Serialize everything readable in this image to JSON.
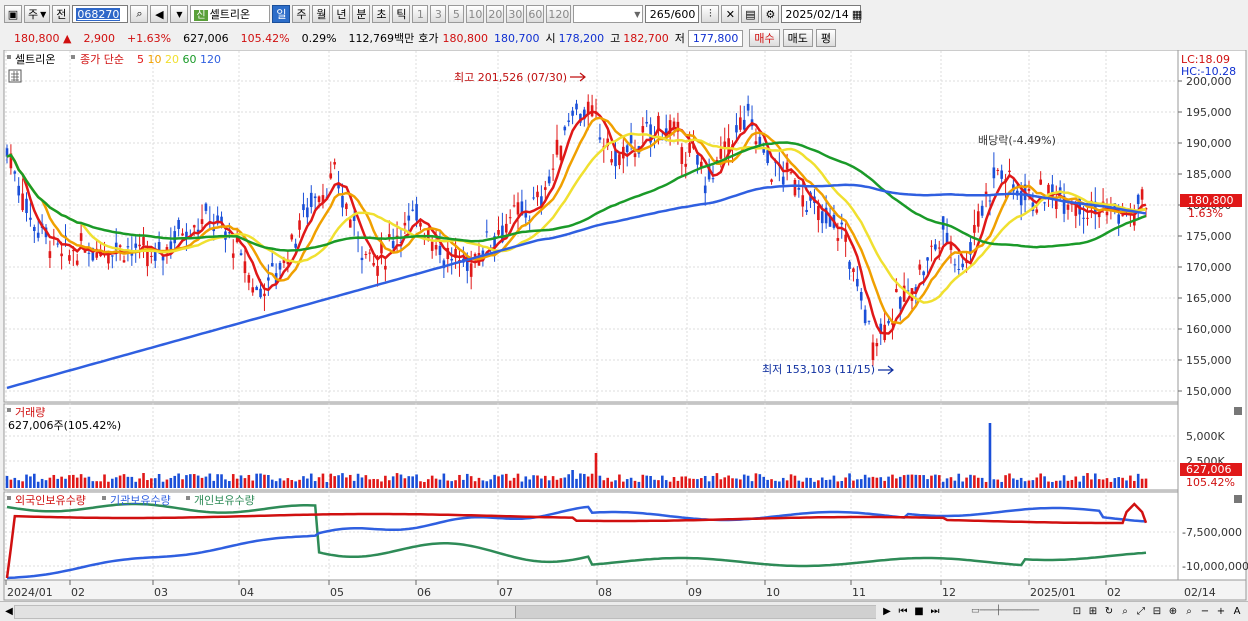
{
  "toolbar": {
    "market": "주",
    "prev": "전",
    "code": "068270",
    "badge": "신",
    "name": "셀트리온",
    "periods": [
      "일",
      "주",
      "월",
      "년",
      "분",
      "초",
      "틱"
    ],
    "intervals": [
      "1",
      "3",
      "5",
      "10",
      "20",
      "30",
      "60",
      "120"
    ],
    "count": "265",
    "count_max": "/600",
    "date": "2025/02/14"
  },
  "quote": {
    "price": "180,800",
    "change_symbol": "▲",
    "change": "2,900",
    "change_pct": "+1.63%",
    "volume": "627,006",
    "volume_ratio": "105.42%",
    "turnover": "0.29%",
    "amount": "112,769백만",
    "bid_label": "호가",
    "ask": "180,800",
    "bid": "180,700",
    "open_label": "시",
    "open": "178,200",
    "high_label": "고",
    "high": "182,700",
    "low_label": "저",
    "low": "177,800",
    "buy": "매수",
    "sell": "매도",
    "eval": "평"
  },
  "price_panel": {
    "name": "셀트리온",
    "legend_prefix": "종가 단순",
    "ma": [
      {
        "label": "5",
        "color": "#e01818"
      },
      {
        "label": "10",
        "color": "#f0a000"
      },
      {
        "label": "20",
        "color": "#f0e030"
      },
      {
        "label": "60",
        "color": "#1a9a28"
      },
      {
        "label": "120",
        "color": "#2f5fe0"
      }
    ],
    "lc": "LC:18.09",
    "hc": "HC:-10.28",
    "y_ticks": [
      "200,000",
      "195,000",
      "190,000",
      "185,000",
      "180,000",
      "175,000",
      "170,000",
      "165,000",
      "160,000",
      "155,000",
      "150,000"
    ],
    "current_price": "180,800",
    "current_pct": "1.63%",
    "max_note": "최고 201,526 (07/30)",
    "min_note": "최저 153,103 (11/15)",
    "div_note": "배당락(-4.49%)"
  },
  "volume_panel": {
    "title": "거래량",
    "subtitle": "627,006주(105.42%)",
    "y_ticks": [
      "5,000K",
      "2,500K"
    ],
    "current": "627,006",
    "current_pct": "105.42%"
  },
  "holdings_panel": {
    "legend": [
      {
        "label": "외국인보유수량",
        "color": "#d01010"
      },
      {
        "label": "기관보유수량",
        "color": "#2f5fe0"
      },
      {
        "label": "개인보유수량",
        "color": "#2e8b57"
      }
    ],
    "y_ticks": [
      "-7,500,000",
      "-10,000,000"
    ]
  },
  "x_axis": [
    "2024/01",
    "02",
    "03",
    "04",
    "05",
    "06",
    "07",
    "08",
    "09",
    "10",
    "11",
    "12",
    "2025/01",
    "02"
  ],
  "x_axis_right": "02/14",
  "colors": {
    "up": "#e01818",
    "down": "#1a4fd8",
    "chart_bg": "#ffffff",
    "grid": "#dcdcdc"
  }
}
